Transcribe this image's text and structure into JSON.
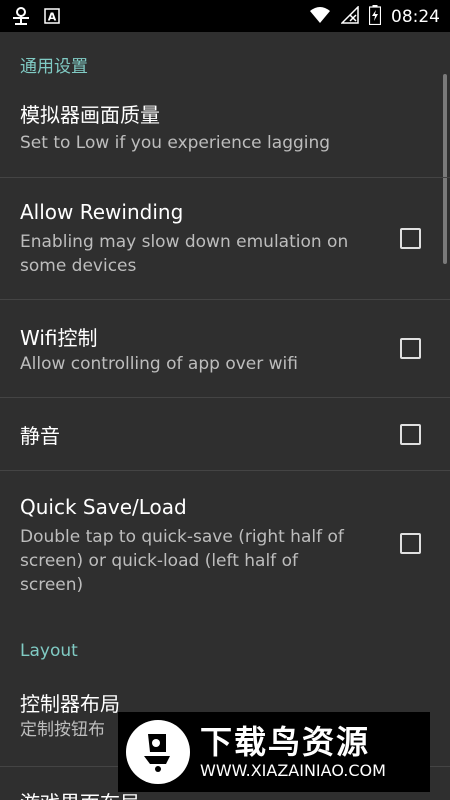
{
  "status_bar": {
    "time": "08:24",
    "left_icons": [
      "bug-icon",
      "a-notification-icon"
    ],
    "right_icons": [
      "wifi-icon",
      "no-signal-icon",
      "battery-charging-icon"
    ]
  },
  "sections": [
    {
      "header": "通用设置",
      "items": [
        {
          "title": "模拟器画面质量",
          "summary": "Set to Low if you experience lagging"
        },
        {
          "title": "Allow Rewinding",
          "summary": "Enabling may slow down emulation on some devices",
          "checked": false
        },
        {
          "title": "Wifi控制",
          "summary": "Allow controlling of app over wifi",
          "checked": false
        },
        {
          "title": "静音",
          "checked": false
        },
        {
          "title": "Quick Save/Load",
          "summary": "Double tap to quick-save (right half of screen) or quick-load (left half of screen)",
          "checked": false
        }
      ]
    },
    {
      "header": "Layout",
      "items": [
        {
          "title": "控制器布局",
          "summary": "定制按钮布"
        },
        {
          "title": "游戏界面布局"
        }
      ]
    }
  ],
  "watermark": {
    "title": "下载鸟资源",
    "url": "WWW.XIAZAINIAO.COM"
  },
  "colors": {
    "background": "#2f2f2f",
    "accent": "#80cbc4",
    "status_bar": "#000000"
  }
}
